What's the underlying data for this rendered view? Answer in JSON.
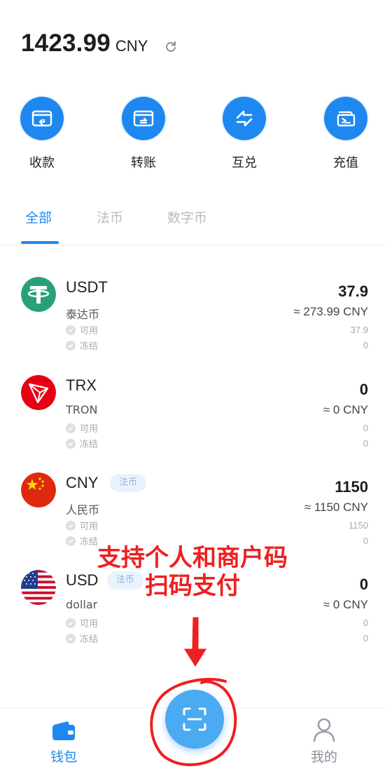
{
  "balance": {
    "amount": "1423.99",
    "unit": "CNY"
  },
  "actions": [
    {
      "label": "收款",
      "icon": "receive-icon"
    },
    {
      "label": "转账",
      "icon": "transfer-icon"
    },
    {
      "label": "互兑",
      "icon": "exchange-icon"
    },
    {
      "label": "充值",
      "icon": "topup-icon"
    }
  ],
  "tabs": [
    {
      "label": "全部",
      "active": true
    },
    {
      "label": "法币",
      "active": false
    },
    {
      "label": "数字币",
      "active": false
    }
  ],
  "status_labels": {
    "available": "可用",
    "frozen": "冻结"
  },
  "coins": [
    {
      "symbol": "USDT",
      "name": "泰达币",
      "tag": "",
      "total": "37.9",
      "approx": "≈ 273.99 CNY",
      "available": "37.9",
      "frozen": "0"
    },
    {
      "symbol": "TRX",
      "name": "TRON",
      "tag": "",
      "total": "0",
      "approx": "≈ 0 CNY",
      "available": "0",
      "frozen": "0"
    },
    {
      "symbol": "CNY",
      "name": "人民币",
      "tag": "法币",
      "total": "1150",
      "approx": "≈ 1150 CNY",
      "available": "1150",
      "frozen": "0"
    },
    {
      "symbol": "USD",
      "name": "dollar",
      "tag": "法币",
      "total": "0",
      "approx": "≈ 0 CNY",
      "available": "0",
      "frozen": "0"
    }
  ],
  "promo": {
    "line1": "支持个人和商户码",
    "line2": "扫码支付"
  },
  "nav": {
    "wallet": {
      "label": "钱包",
      "icon": "wallet-icon",
      "active": true
    },
    "scan": {
      "icon": "scan-icon"
    },
    "mine": {
      "label": "我的",
      "icon": "user-icon",
      "active": false
    }
  },
  "colors": {
    "accent": "#1e88f0",
    "promo_red": "#ee2020",
    "usdt_green": "#26a17b",
    "tron_red": "#e60012"
  }
}
